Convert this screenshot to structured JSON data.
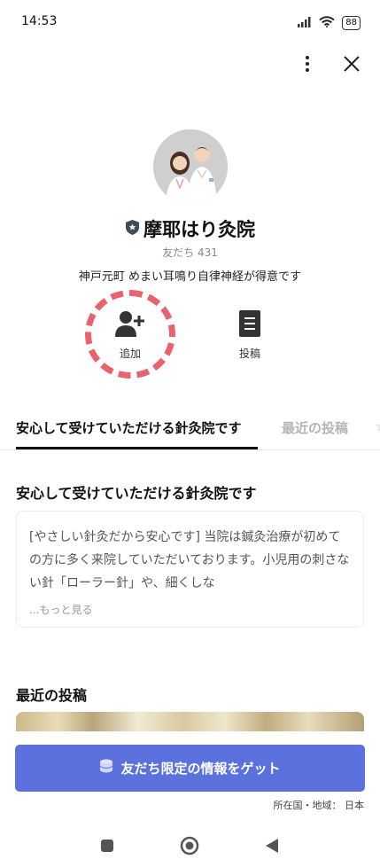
{
  "status_bar": {
    "time": "14:53",
    "battery": "88",
    "icons": [
      "signal-icon",
      "wifi-icon",
      "battery-icon"
    ]
  },
  "header": {
    "icons": [
      "more-vertical-icon",
      "close-icon"
    ]
  },
  "profile": {
    "name": "摩耶はり灸院",
    "friends": "友だち 431",
    "description": "神戸元町 めまい耳鳴り自律神経が得意です",
    "badge_icon": "shield-badge-icon"
  },
  "actions": {
    "add_label": "追加",
    "posts_label": "投稿",
    "highlight_color": "#e8636e"
  },
  "tabs": [
    {
      "label": "安心して受けていただける針灸院です",
      "active": true
    },
    {
      "label": "最近の投稿",
      "active": false
    },
    {
      "label": "☆",
      "active": false
    }
  ],
  "intro": {
    "title": "安心して受けていただける針灸院です",
    "text": "[やさしい針灸だから安心です] 当院は鍼灸治療が初めての方に多く来院していただいております。小児用の刺さない針「ローラー針」や、細くしな",
    "more_label": "...もっと見る"
  },
  "recent": {
    "title": "最近の投稿"
  },
  "cta": {
    "label": "友だち限定の情報をゲット",
    "icon": "coins-icon",
    "color": "#5b72de"
  },
  "location": "所在国・地域： 日本",
  "nav": {
    "icons": [
      "recent-apps-icon",
      "home-icon",
      "back-icon"
    ]
  }
}
